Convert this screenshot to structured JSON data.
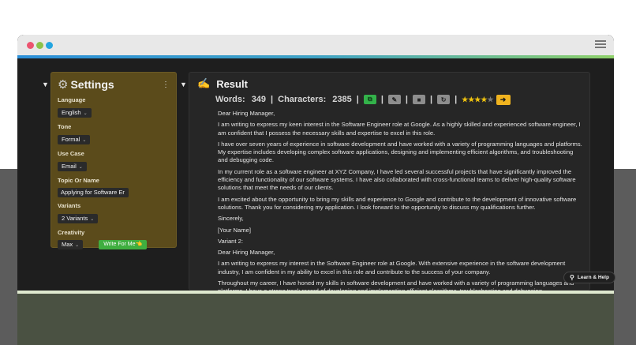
{
  "window": {
    "menu_icon": "hamburger-icon"
  },
  "settings": {
    "title": "Settings",
    "icon": "gear-icon",
    "fields": {
      "language": {
        "label": "Language",
        "value": "English"
      },
      "tone": {
        "label": "Tone",
        "value": "Formal"
      },
      "use_case": {
        "label": "Use Case",
        "value": "Email"
      },
      "topic": {
        "label": "Topic Or Name",
        "value": "Applying for Software Er"
      },
      "variants": {
        "label": "Variants",
        "value": "2 Variants"
      },
      "creativity": {
        "label": "Creativity",
        "value": "Max"
      }
    },
    "write_button": "Write For Me👈"
  },
  "result": {
    "title": "Result",
    "icon": "writing-hand-icon",
    "words_label": "Words:",
    "words_value": "349",
    "characters_label": "Characters:",
    "characters_value": "2385",
    "rating": 4,
    "rating_max": 5,
    "paragraphs": [
      "Dear Hiring Manager,",
      "I am writing to express my keen interest in the Software Engineer role at Google. As a highly skilled and experienced software engineer, I am confident that I possess the necessary skills and expertise to excel in this role.",
      "I have over seven years of experience in software development and have worked with a variety of programming languages and platforms. My expertise includes developing complex software applications, designing and implementing efficient algorithms, and troubleshooting and debugging code.",
      "In my current role as a software engineer at XYZ Company, I have led several successful projects that have significantly improved the efficiency and functionality of our software systems. I have also collaborated with cross-functional teams to deliver high-quality software solutions that meet the needs of our clients.",
      "I am excited about the opportunity to bring my skills and experience to Google and contribute to the development of innovative software solutions. Thank you for considering my application. I look forward to the opportunity to discuss my qualifications further.",
      "Sincerely,",
      "[Your Name]",
      "Variant 2:",
      "Dear Hiring Manager,",
      "I am writing to express my interest in the Software Engineer role at Google. With extensive experience in the software development industry, I am confident in my ability to excel in this role and contribute to the success of your company.",
      "Throughout my career, I have honed my skills in software development and have worked with a variety of programming languages and platforms. I have a strong track record of developing and implementing efficient algorithms, troubleshooting and debugging"
    ]
  },
  "help": {
    "label": "Learn & Help",
    "icon": "pin-icon"
  },
  "colors": {
    "settings_bg": "#5b4b1b",
    "result_bg": "#262626",
    "copy_button": "#33b24a",
    "next_button": "#f0b31f",
    "write_button": "#3fae3f"
  }
}
